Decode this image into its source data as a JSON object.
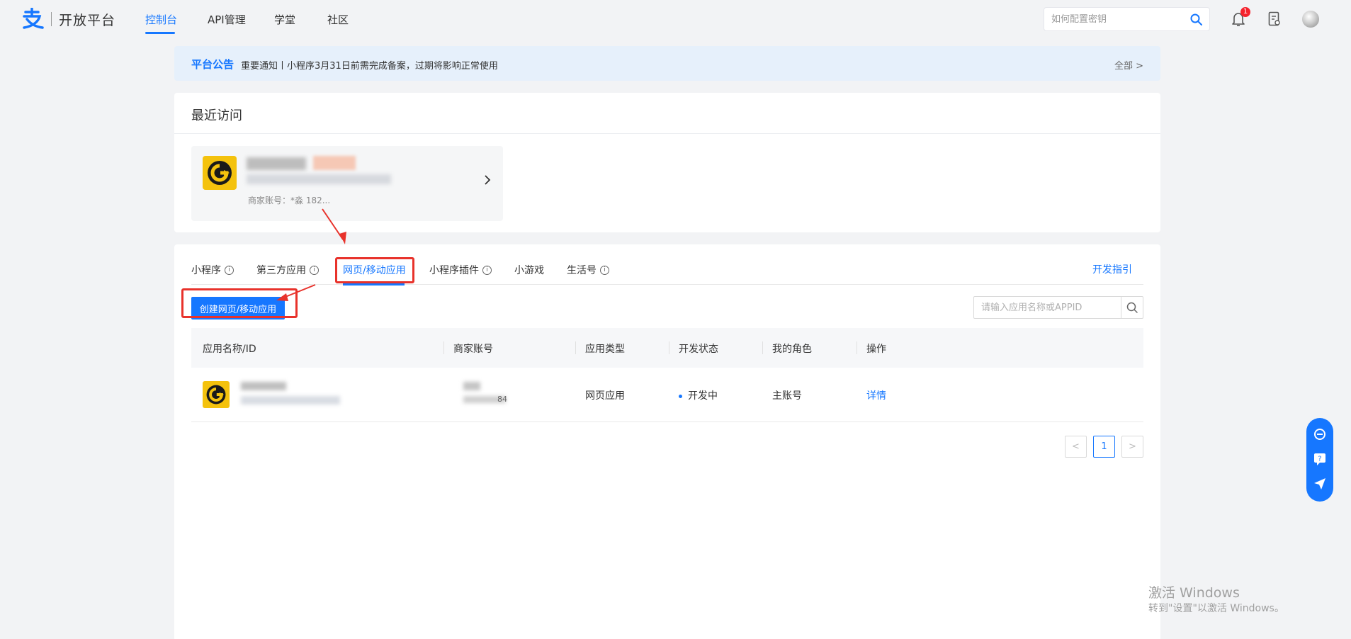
{
  "brand": {
    "name": "开放平台"
  },
  "nav": {
    "items": [
      {
        "label": "控制台"
      },
      {
        "label": "API管理"
      },
      {
        "label": "学堂"
      },
      {
        "label": "社区"
      }
    ],
    "search_placeholder": "如何配置密钥",
    "notification_count": "1"
  },
  "announcement": {
    "tag": "平台公告",
    "message": "重要通知丨小程序3月31日前需完成备案，过期将影响正常使用",
    "all_label": "全部 >"
  },
  "recent": {
    "title": "最近访问",
    "merchant_meta": "商家账号：*淼 182..."
  },
  "tabs": {
    "items": [
      {
        "label": "小程序"
      },
      {
        "label": "第三方应用"
      },
      {
        "label": "网页/移动应用"
      },
      {
        "label": "小程序插件"
      },
      {
        "label": "小游戏"
      },
      {
        "label": "生活号"
      }
    ],
    "active": "网页/移动应用",
    "dev_guide": "开发指引"
  },
  "toolbar": {
    "create_label": "创建网页/移动应用",
    "search_placeholder": "请输入应用名称或APPID"
  },
  "table": {
    "columns": [
      "应用名称/ID",
      "商家账号",
      "应用类型",
      "开发状态",
      "我的角色",
      "操作"
    ],
    "rows": [
      {
        "merchant_tail": "84",
        "type": "网页应用",
        "status": "开发中",
        "role": "主账号",
        "action": "详情"
      }
    ]
  },
  "pagination": {
    "prev": "<",
    "current": "1",
    "next": ">"
  },
  "watermark": {
    "line1": "激活 Windows",
    "line2": "转到\"设置\"以激活 Windows。"
  },
  "colors": {
    "primary": "#1677ff",
    "annotation": "#e8322b",
    "app_logo": "#f4c20d"
  }
}
